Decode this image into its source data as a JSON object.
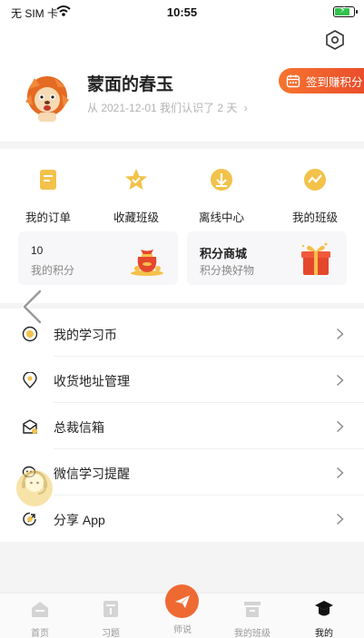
{
  "status_bar": {
    "carrier": "无 SIM 卡",
    "time": "10:55",
    "battery_color": "#32c24d"
  },
  "profile": {
    "username": "蒙面的春玉",
    "since_text": "从 2021-12-01 我们认识了 2 天",
    "checkin_label": "签到赚积分",
    "avatar_icon": "lion-avatar"
  },
  "quick_actions": [
    {
      "label": "我的订单",
      "icon": "order-icon"
    },
    {
      "label": "收藏班级",
      "icon": "star-icon"
    },
    {
      "label": "离线中心",
      "icon": "download-icon"
    },
    {
      "label": "我的班级",
      "icon": "class-icon"
    }
  ],
  "points_card": {
    "value": "10",
    "label": "我的积分"
  },
  "mall_card": {
    "title": "积分商城",
    "subtitle": "积分换好物"
  },
  "menu": [
    {
      "label": "我的学习币",
      "icon": "coin-icon"
    },
    {
      "label": "收货地址管理",
      "icon": "location-icon"
    },
    {
      "label": "总裁信箱",
      "icon": "mailbox-icon"
    },
    {
      "label": "微信学习提醒",
      "icon": "wechat-icon"
    },
    {
      "label": "分享 App",
      "icon": "share-icon"
    }
  ],
  "tabbar": [
    {
      "label": "首页",
      "icon": "home-icon"
    },
    {
      "label": "习题",
      "icon": "exercise-icon"
    },
    {
      "label": "师说",
      "icon": "paper-plane-icon"
    },
    {
      "label": "我的班级",
      "icon": "classroom-icon"
    },
    {
      "label": "我的",
      "icon": "graduation-cap-icon"
    }
  ],
  "colors": {
    "accent_orange": "#ef6a32",
    "icon_gold": "#f2c24b",
    "text_muted": "#b2b2b2"
  }
}
